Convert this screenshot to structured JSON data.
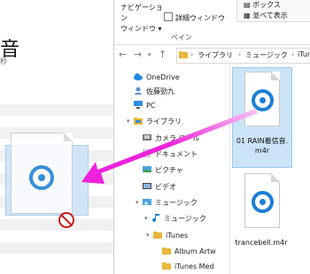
{
  "left_app": {
    "title": "音",
    "subtitle": "秒"
  },
  "ribbon": {
    "nav_pane_line1": "ナビゲーション",
    "nav_pane_line2": "ウィンドウ",
    "detail_pane": "詳細ウィンドウ",
    "group_label": "ペイン",
    "layout_item1": "ボックス",
    "layout_item2": "並べて表示"
  },
  "address": {
    "back": "←",
    "forward": "→",
    "up": "↑",
    "path": [
      "ライブラリ",
      "ミュージック",
      "iTun"
    ]
  },
  "nav_pane": {
    "items": [
      {
        "label": "OneDrive",
        "icon": "cloud-icon"
      },
      {
        "label": "佐藤勁九",
        "icon": "user-icon"
      },
      {
        "label": "PC",
        "icon": "pc-icon"
      },
      {
        "label": "ライブラリ",
        "icon": "library-icon"
      },
      {
        "label": "カメラ ロール",
        "icon": "camera-roll-icon"
      },
      {
        "label": "ドキュメント",
        "icon": "documents-icon"
      },
      {
        "label": "ピクチャ",
        "icon": "pictures-icon"
      },
      {
        "label": "ビデオ",
        "icon": "video-icon"
      },
      {
        "label": "ミュージック",
        "icon": "music-icon"
      },
      {
        "label": "ミュージック",
        "icon": "music-note-icon"
      },
      {
        "label": "iTunes",
        "icon": "folder-icon"
      },
      {
        "label": "Album Artw",
        "icon": "folder-icon"
      },
      {
        "label": "iTunes Med",
        "icon": "folder-icon"
      }
    ]
  },
  "files": [
    {
      "name_line1": "01 RAIN着信音.",
      "name_line2": "m4r",
      "selected": true
    },
    {
      "name_line1": "trancebell.m4r",
      "name_line2": "",
      "selected": false
    }
  ],
  "colors": {
    "accent": "#1b7fd6",
    "selection": "#cce4f7",
    "arrow": "#ee22dd",
    "nodrop": "#cc1a1a"
  }
}
